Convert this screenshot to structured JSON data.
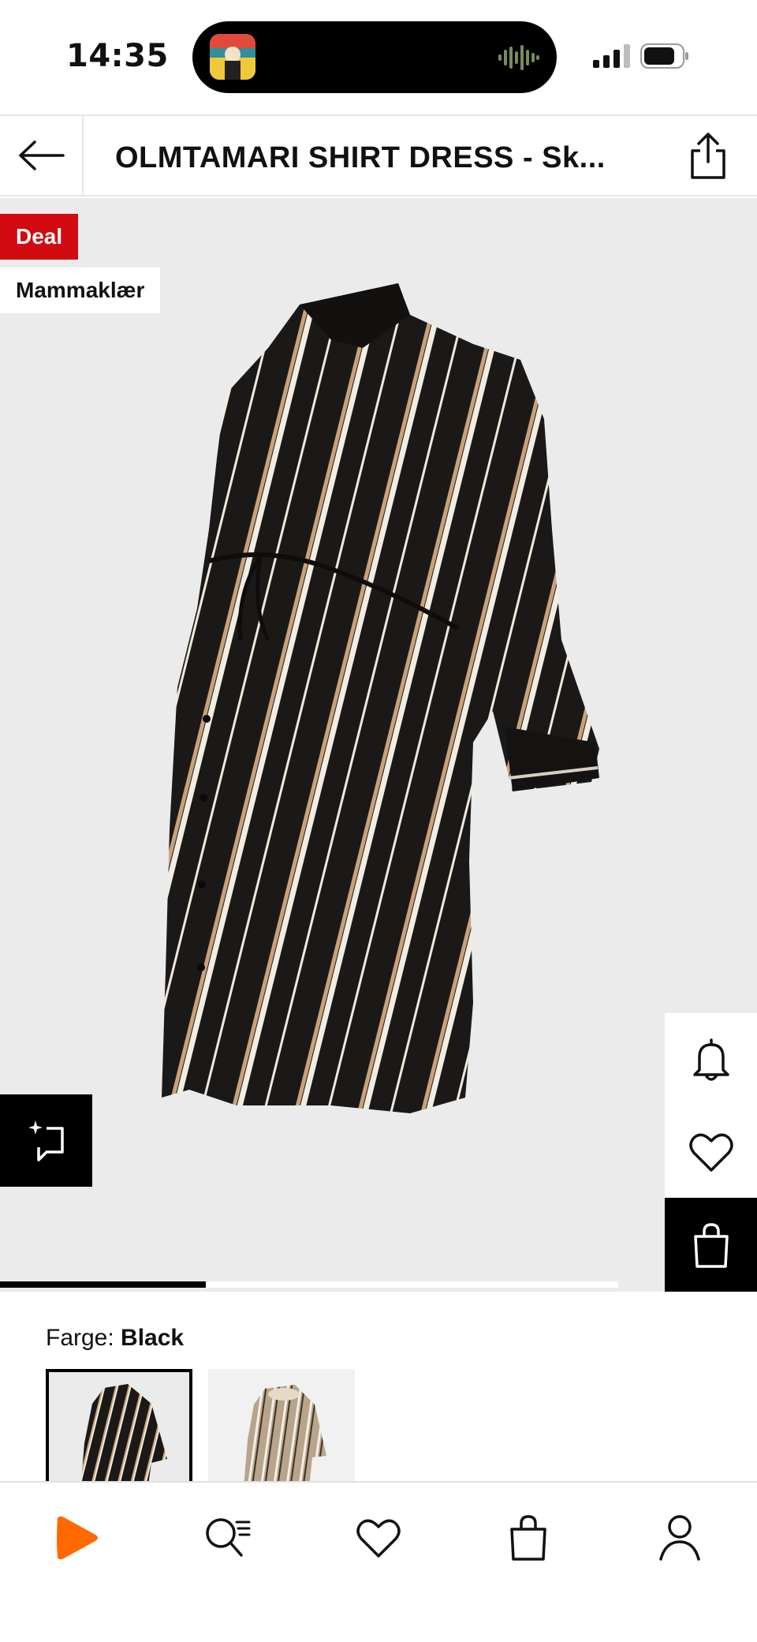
{
  "status_bar": {
    "time": "14:35",
    "icons": [
      "music-artwork-thumbnail",
      "audio-waveform-icon",
      "cellular-signal-icon",
      "battery-icon"
    ]
  },
  "header": {
    "title": "OLMTAMARI SHIRT DRESS - Sk...",
    "icons": [
      "back-arrow-icon",
      "share-icon"
    ]
  },
  "product": {
    "badges": {
      "deal": "Deal",
      "category": "Mammaklær"
    },
    "deal_color": "#d20a11",
    "image_subject": "black striped maternity shirt dress",
    "carousel_position": {
      "current": 1,
      "total": 3
    },
    "actions": [
      "find-similar-icon",
      "bell-icon",
      "heart-icon",
      "shopping-bag-icon"
    ]
  },
  "color_selector": {
    "label": "Farge:",
    "selected": "Black",
    "swatches": [
      {
        "color_name": "Black",
        "selected": true
      },
      {
        "color_name": "Beige stripe",
        "selected": false
      }
    ]
  },
  "bottom_nav": {
    "accent_color": "#ff6900",
    "items": [
      "zalando-home-icon",
      "search-icon",
      "wishlist-heart-icon",
      "bag-icon",
      "profile-icon"
    ]
  }
}
